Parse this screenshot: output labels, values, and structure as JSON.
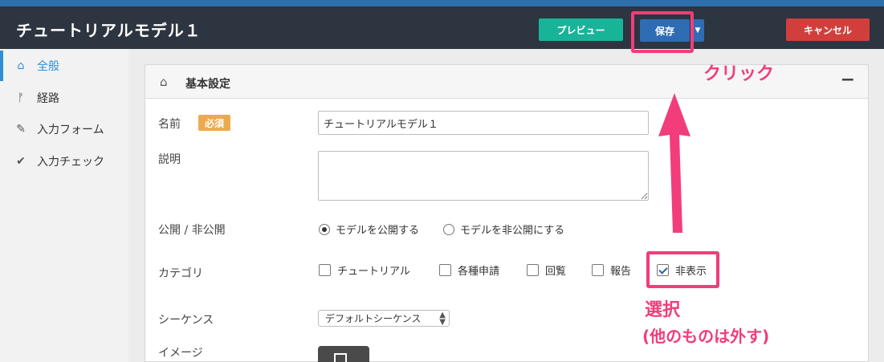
{
  "header": {
    "title": "チュートリアルモデル１",
    "preview_label": "プレビュー",
    "save_label": "保存",
    "cancel_label": "キャンセル"
  },
  "sidebar": {
    "items": [
      {
        "label": "全般",
        "icon": "home-icon",
        "active": true
      },
      {
        "label": "経路",
        "icon": "route-icon",
        "active": false
      },
      {
        "label": "入力フォーム",
        "icon": "pencil-icon",
        "active": false
      },
      {
        "label": "入力チェック",
        "icon": "check-icon",
        "active": false
      }
    ]
  },
  "panel": {
    "title": "基本設定",
    "fields": {
      "name_label": "名前",
      "required_badge": "必須",
      "name_value": "チュートリアルモデル１",
      "description_label": "説明",
      "description_value": "",
      "visibility_label": "公開 / 非公開",
      "visibility_options": [
        "モデルを公開する",
        "モデルを非公開にする"
      ],
      "visibility_selected": "モデルを公開する",
      "category_label": "カテゴリ",
      "category_options": [
        {
          "label": "チュートリアル",
          "checked": false
        },
        {
          "label": "各種申請",
          "checked": false
        },
        {
          "label": "回覧",
          "checked": false
        },
        {
          "label": "報告",
          "checked": false
        },
        {
          "label": "非表示",
          "checked": true
        }
      ],
      "sequence_label": "シーケンス",
      "sequence_value": "デフォルトシーケンス",
      "image_label": "イメージ"
    }
  },
  "annotations": {
    "click": "クリック",
    "select": "選択",
    "note": "(他のものは外す)"
  },
  "colors": {
    "header_bg": "#2d3540",
    "preview": "#18b49a",
    "save": "#2e6cb4",
    "cancel": "#d13f3c",
    "badge": "#ecaa4f",
    "highlight": "#f23d7a",
    "active_nav": "#2f8fd6"
  }
}
